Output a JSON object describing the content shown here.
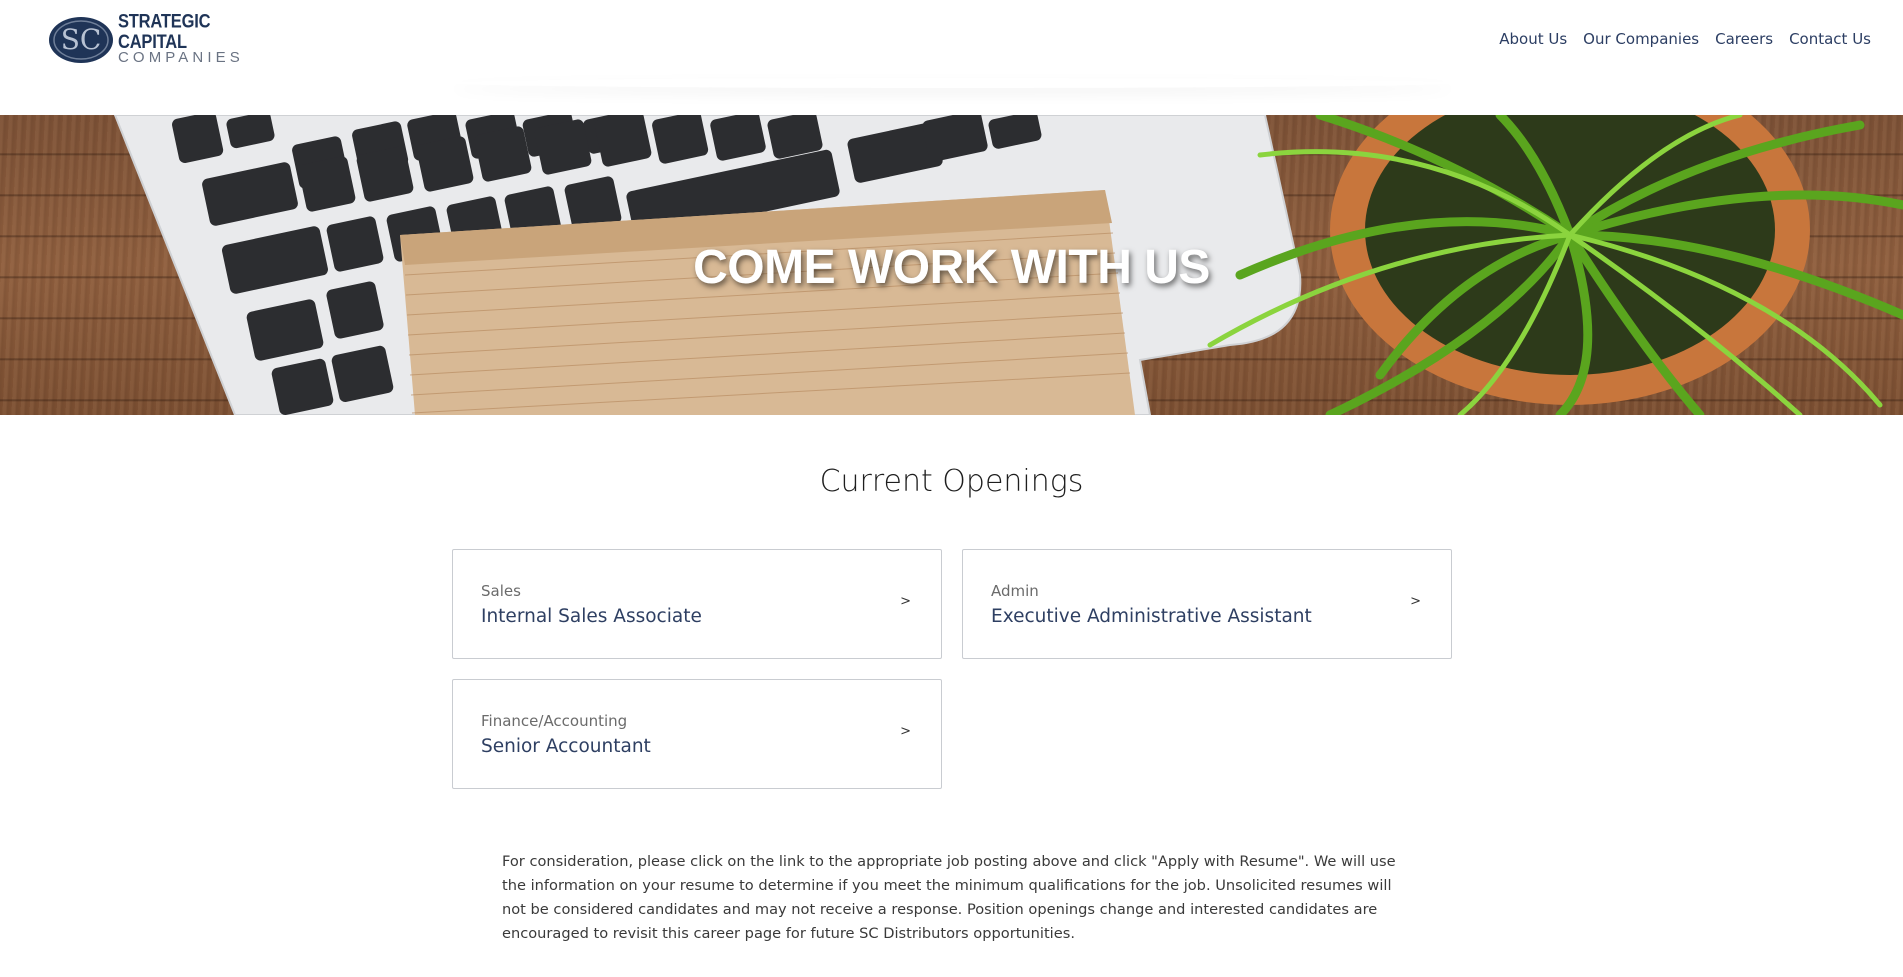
{
  "header": {
    "logo": {
      "initials": "SC",
      "line1": "STRATEGIC CAPITAL",
      "line2": "COMPANIES"
    },
    "nav": [
      {
        "label": "About Us"
      },
      {
        "label": "Our Companies"
      },
      {
        "label": "Careers"
      },
      {
        "label": "Contact Us"
      }
    ]
  },
  "hero": {
    "title": "COME WORK WITH US"
  },
  "main": {
    "title": "Current Openings",
    "jobs": [
      {
        "category": "Sales",
        "title": "Internal Sales Associate",
        "arrow": ">"
      },
      {
        "category": "Admin",
        "title": "Executive Administrative Assistant",
        "arrow": ">"
      },
      {
        "category": "Finance/Accounting",
        "title": "Senior Accountant",
        "arrow": ">"
      }
    ],
    "note": "For consideration, please click on the link to the appropriate job posting above and click \"Apply with Resume\". We will use the information on your resume to determine if you meet the minimum qualifications for the job. Unsolicited resumes will not be considered candidates and may not receive a response. Position openings change and interested candidates are encouraged to revisit this career page for future SC Distributors opportunities."
  },
  "colors": {
    "brand_navy": "#1f3457",
    "nav_text": "#2c3e63",
    "job_title": "#2e3f62",
    "card_border": "#c9ccd1"
  }
}
